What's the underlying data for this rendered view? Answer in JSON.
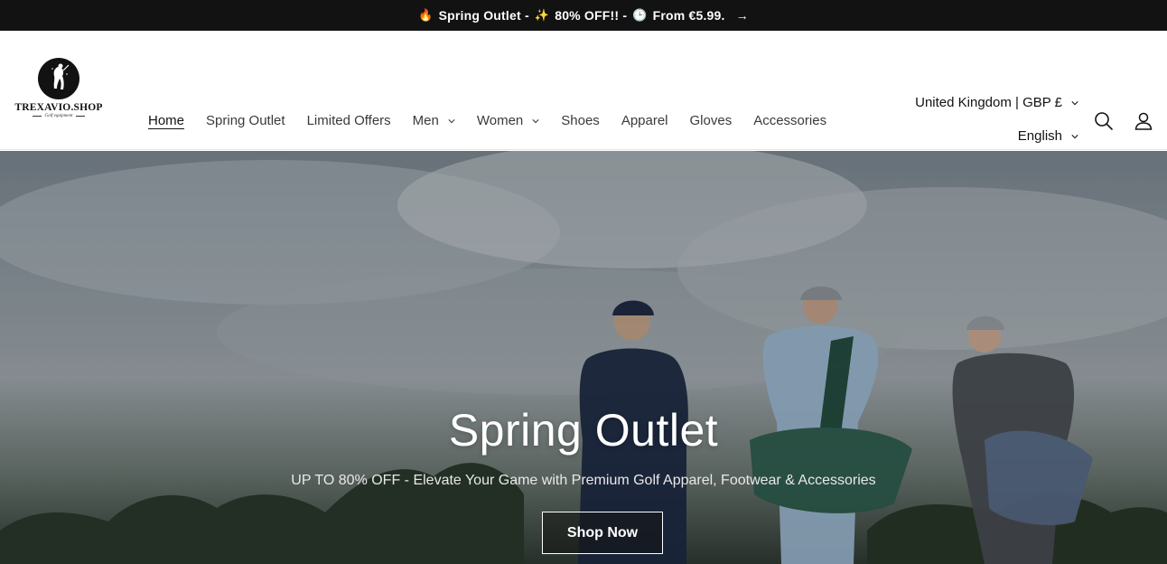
{
  "announcement": {
    "fire_emoji": "🔥",
    "part1": "Spring Outlet -",
    "sparkle_emoji": "✨",
    "part2": "80% OFF!! -",
    "clock_emoji": "🕒",
    "part3": "From €5.99.",
    "arrow": "→"
  },
  "logo": {
    "name": "TREXAVIO.SHOP",
    "tagline": "Golf equipment"
  },
  "nav": {
    "items": [
      {
        "label": "Home",
        "active": true,
        "dropdown": false
      },
      {
        "label": "Spring Outlet",
        "active": false,
        "dropdown": false
      },
      {
        "label": "Limited Offers",
        "active": false,
        "dropdown": false
      },
      {
        "label": "Men",
        "active": false,
        "dropdown": true
      },
      {
        "label": "Women",
        "active": false,
        "dropdown": true
      },
      {
        "label": "Shoes",
        "active": false,
        "dropdown": false
      },
      {
        "label": "Apparel",
        "active": false,
        "dropdown": false
      },
      {
        "label": "Gloves",
        "active": false,
        "dropdown": false
      },
      {
        "label": "Accessories",
        "active": false,
        "dropdown": false
      }
    ]
  },
  "locale": {
    "country": "United Kingdom | GBP £",
    "language": "English"
  },
  "icons": {
    "search": "search-icon",
    "account": "account-icon"
  },
  "hero": {
    "title": "Spring Outlet",
    "subtitle": "UP TO 80% OFF - Elevate Your Game with Premium Golf Apparel, Footwear & Accessories",
    "button": "Shop Now"
  },
  "colors": {
    "announcement_bg": "#121212",
    "text": "#121212",
    "hero_button_border": "#ffffff"
  }
}
